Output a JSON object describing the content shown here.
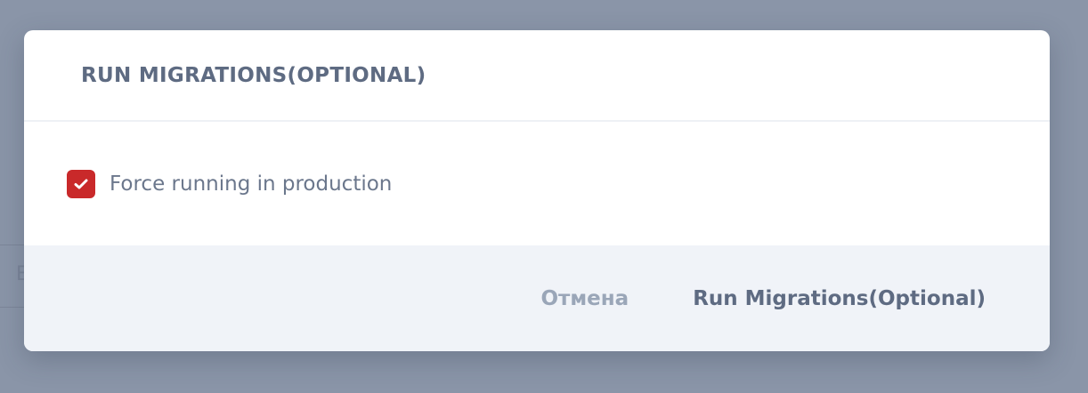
{
  "modal": {
    "title": "RUN MIGRATIONS(OPTIONAL)",
    "checkbox": {
      "label": "Force running in production",
      "checked": true,
      "color": "#c9292a"
    },
    "cancel_label": "Отмена",
    "submit_label": "Run Migrations(Optional)"
  }
}
